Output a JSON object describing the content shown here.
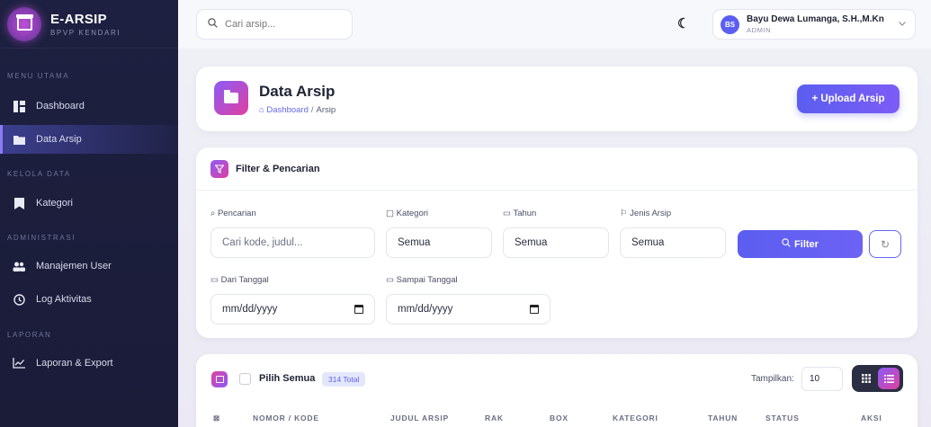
{
  "brand": {
    "title": "E-ARSIP",
    "subtitle": "BPVP KENDARI"
  },
  "sidebar": {
    "sections": [
      {
        "label": "MENU UTAMA"
      },
      {
        "label": "KELOLA DATA"
      },
      {
        "label": "ADMINISTRASI"
      },
      {
        "label": "LAPORAN"
      }
    ],
    "items": [
      {
        "label": "Dashboard",
        "icon": "dashboard-icon"
      },
      {
        "label": "Data Arsip",
        "icon": "folder-icon",
        "active": true
      },
      {
        "label": "Kategori",
        "icon": "bookmark-icon"
      },
      {
        "label": "Manajemen User",
        "icon": "users-icon"
      },
      {
        "label": "Log Aktivitas",
        "icon": "clock-icon"
      },
      {
        "label": "Laporan & Export",
        "icon": "chart-icon"
      }
    ]
  },
  "topbar": {
    "search_placeholder": "Cari arsip...",
    "user": {
      "initials": "BS",
      "name": "Bayu Dewa Lumanga, S.H.,M.Kn",
      "role": "ADMIN"
    }
  },
  "header": {
    "title": "Data Arsip",
    "breadcrumb": {
      "home": "Dashboard",
      "separator": "/",
      "current": "Arsip"
    },
    "upload_label": "+ Upload Arsip"
  },
  "filter": {
    "title": "Filter & Pencarian",
    "search": {
      "label": "Pencarian",
      "placeholder": "Cari kode, judul..."
    },
    "kategori": {
      "label": "Kategori",
      "value": "Semua"
    },
    "tahun": {
      "label": "Tahun",
      "value": "Semua"
    },
    "jenis": {
      "label": "Jenis Arsip",
      "value": "Semua"
    },
    "dari": {
      "label": "Dari Tanggal",
      "value": "mm/dd/yyyy"
    },
    "sampai": {
      "label": "Sampai Tanggal",
      "value": "mm/dd/yyyy"
    },
    "filter_label": "Filter",
    "reset_icon": "↻"
  },
  "table": {
    "select_all_label": "Pilih Semua",
    "total_badge": "314 Total",
    "show_label": "Tampilkan:",
    "per_page": "10",
    "columns": [
      "NOMOR / KODE",
      "JUDUL ARSIP",
      "RAK",
      "BOX",
      "KATEGORI",
      "TAHUN",
      "STATUS",
      "AKSI"
    ]
  },
  "colors": {
    "accent": "#5b5ef0",
    "sidebar": "#1d2040",
    "gradient_pink": "#e040a0",
    "gradient_violet": "#8b5cf6"
  }
}
